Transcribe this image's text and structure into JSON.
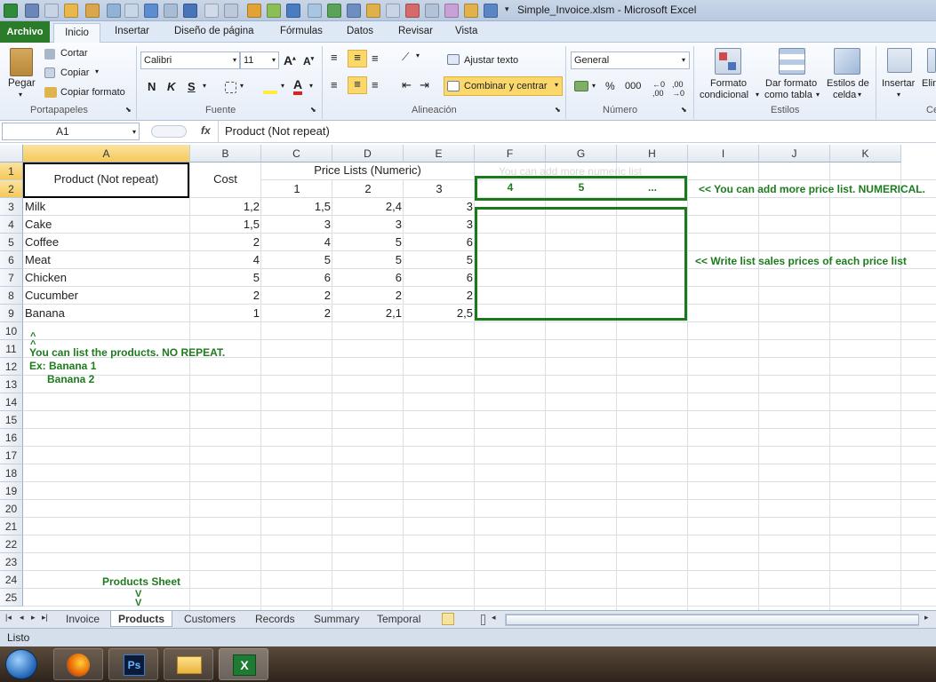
{
  "window": {
    "title": "Simple_Invoice.xlsm - Microsoft Excel"
  },
  "tabs": {
    "archivo": "Archivo",
    "inicio": "Inicio",
    "insertar": "Insertar",
    "diseno": "Diseño de página",
    "formulas": "Fórmulas",
    "datos": "Datos",
    "revisar": "Revisar",
    "vista": "Vista"
  },
  "ribbon": {
    "pegar": "Pegar",
    "cortar": "Cortar",
    "copiar": "Copiar",
    "copiar_formato": "Copiar formato",
    "portapapeles": "Portapapeles",
    "font_name": "Calibri",
    "font_size": "11",
    "fuente": "Fuente",
    "ajustar": "Ajustar texto",
    "combinar": "Combinar y centrar",
    "alineacion": "Alineación",
    "number_format": "General",
    "numero": "Número",
    "formato_cond_1": "Formato",
    "formato_cond_2": "condicional",
    "dar_formato_1": "Dar formato",
    "dar_formato_2": "como tabla",
    "estilos_celda_1": "Estilos de",
    "estilos_celda_2": "celda",
    "estilos": "Estilos",
    "insertar": "Insertar",
    "eliminar": "Elim",
    "celdas": "Ce"
  },
  "formula_bar": {
    "name_box": "A1",
    "fx": "fx",
    "formula": "Product (Not repeat)"
  },
  "columns": [
    "A",
    "B",
    "C",
    "D",
    "E",
    "F",
    "G",
    "H",
    "I",
    "J",
    "K"
  ],
  "rows": [
    "1",
    "2",
    "3",
    "4",
    "5",
    "6",
    "7",
    "8",
    "9",
    "10",
    "11",
    "12",
    "13",
    "14",
    "15",
    "16",
    "17",
    "18",
    "19",
    "20",
    "21",
    "22",
    "23",
    "24",
    "25"
  ],
  "header": {
    "product": "Product (Not repeat)",
    "cost": "Cost",
    "price_lists": "Price Lists (Numeric)",
    "pl": [
      "1",
      "2",
      "3"
    ],
    "more_hint": "You can add more numeric list",
    "extra": [
      "4",
      "5",
      "..."
    ]
  },
  "products": [
    {
      "name": "Milk",
      "cost": "1,2",
      "p1": "1,5",
      "p2": "2,4",
      "p3": "3"
    },
    {
      "name": "Cake",
      "cost": "1,5",
      "p1": "3",
      "p2": "3",
      "p3": "3"
    },
    {
      "name": "Coffee",
      "cost": "2",
      "p1": "4",
      "p2": "5",
      "p3": "6"
    },
    {
      "name": "Meat",
      "cost": "4",
      "p1": "5",
      "p2": "5",
      "p3": "5"
    },
    {
      "name": "Chicken",
      "cost": "5",
      "p1": "6",
      "p2": "6",
      "p3": "6"
    },
    {
      "name": "Cucumber",
      "cost": "2",
      "p1": "2",
      "p2": "2",
      "p3": "2"
    },
    {
      "name": "Banana",
      "cost": "1",
      "p1": "2",
      "p2": "2,1",
      "p3": "2,5"
    }
  ],
  "notes": {
    "add_price": "<< You can add more price list. NUMERICAL.",
    "write_prices": "<< Write list sales prices of each price list",
    "up_arrow": "^\n^",
    "list_products": "You can list the products. NO REPEAT.",
    "example1": "Ex: Banana 1",
    "example2": "Banana 2",
    "products_sheet": "Products Sheet",
    "down_arrow": "V\nV"
  },
  "sheets": [
    "Invoice",
    "Products",
    "Customers",
    "Records",
    "Summary",
    "Temporal"
  ],
  "status": "Listo",
  "colors": {
    "accent_green": "#1a7a1a",
    "archivo_green": "#2a7b2a",
    "selection": "#f5c95a"
  },
  "icons": [
    "pegar-icon",
    "cortar-icon",
    "copiar-icon",
    "copiar-formato-icon",
    "bold-icon",
    "italic-icon",
    "underline-icon",
    "borders-icon",
    "fill-color-icon",
    "font-color-icon",
    "align-top-icon",
    "align-middle-icon",
    "align-bottom-icon",
    "align-left-icon",
    "align-center-icon",
    "align-right-icon",
    "indent-icon",
    "wrap-icon",
    "merge-icon",
    "currency-icon",
    "percent-icon",
    "thousands-icon",
    "conditional-format-icon",
    "format-table-icon",
    "cell-styles-icon",
    "insert-cells-icon",
    "windows-start-icon",
    "firefox-icon",
    "photoshop-icon",
    "explorer-icon",
    "excel-icon"
  ]
}
